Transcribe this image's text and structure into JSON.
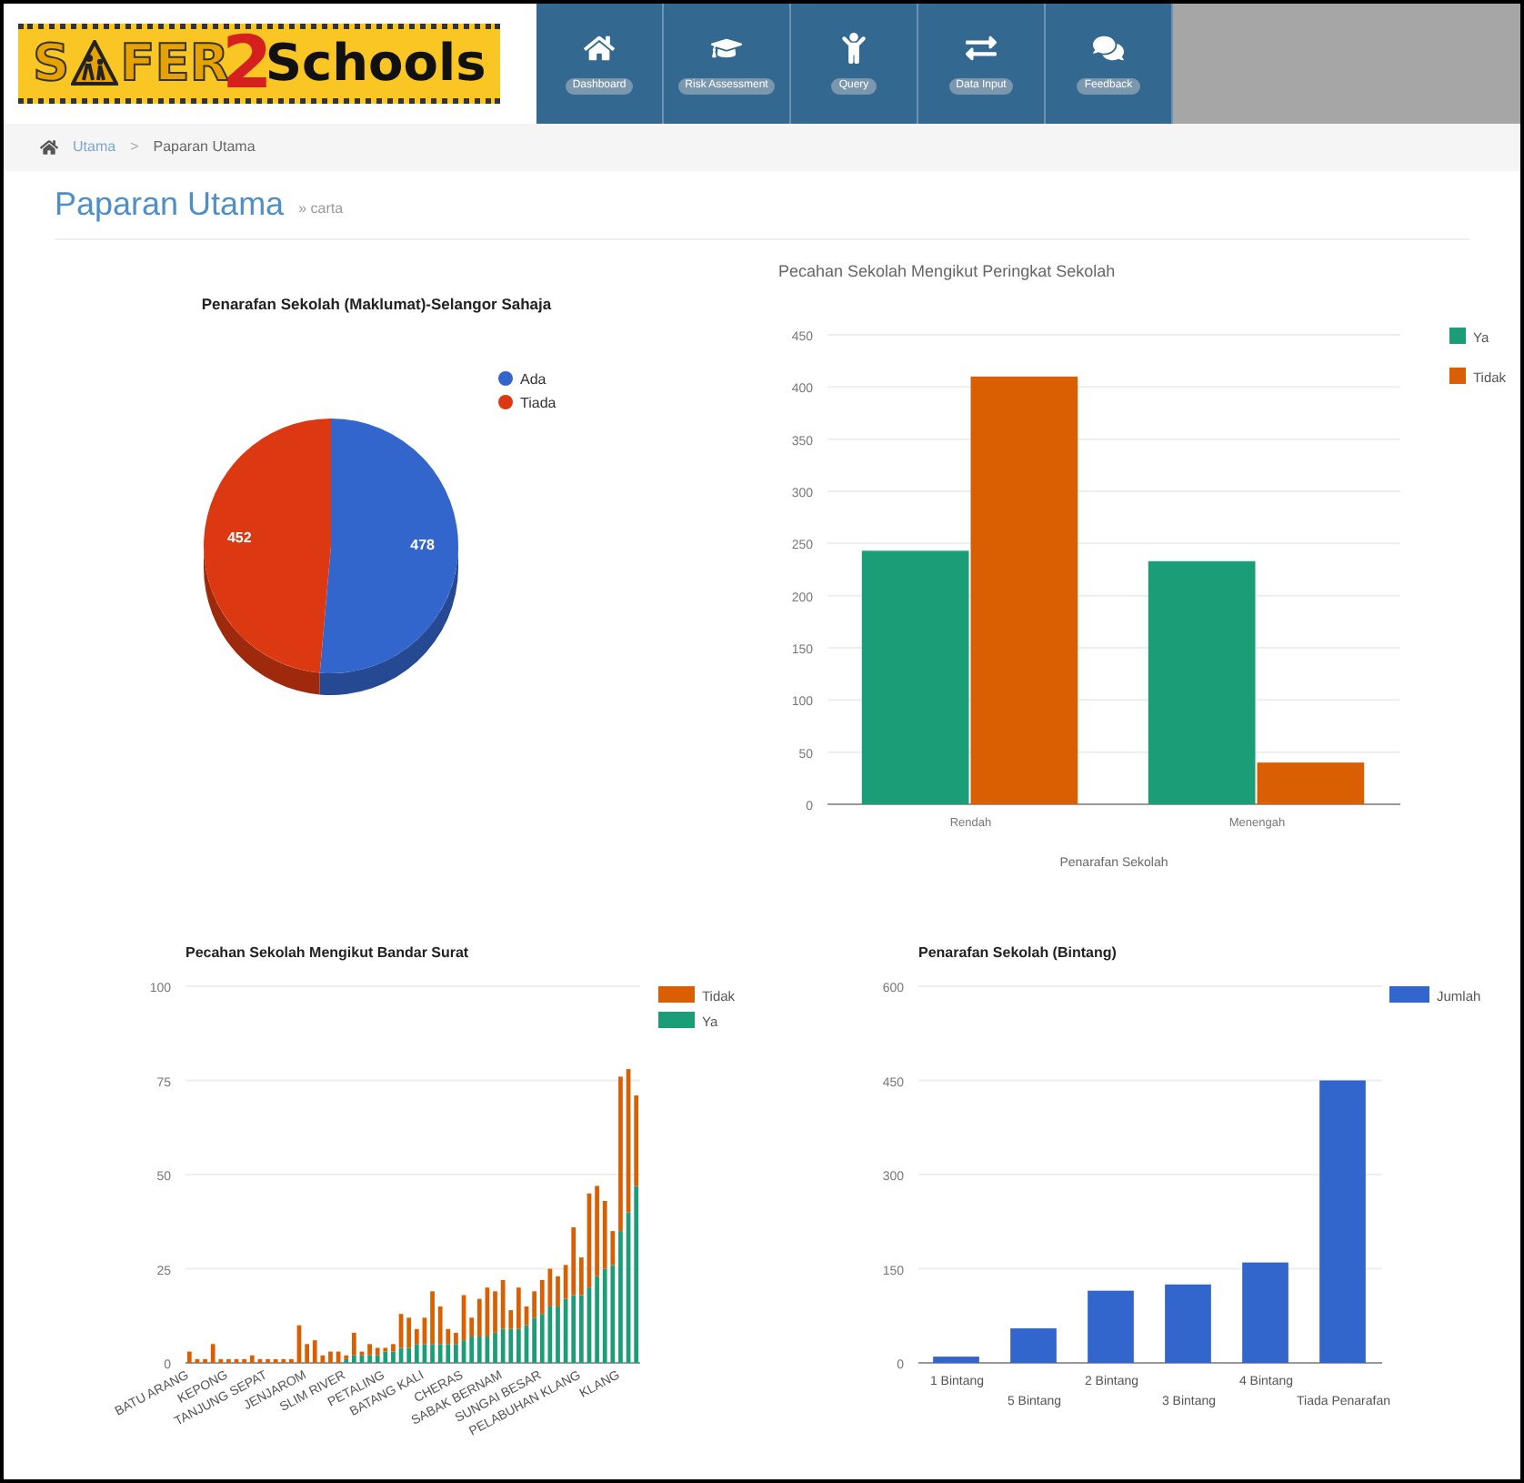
{
  "header": {
    "logo": {
      "left": "S",
      "middle": "FER",
      "numeral": "2",
      "right": "Schools"
    },
    "nav": [
      {
        "label": "Dashboard"
      },
      {
        "label": "Risk Assessment"
      },
      {
        "label": "Query"
      },
      {
        "label": "Data Input"
      },
      {
        "label": "Feedback"
      }
    ]
  },
  "breadcrumb": {
    "items": [
      "Utama",
      "Paparan Utama"
    ],
    "separator": ">"
  },
  "page": {
    "title": "Paparan Utama",
    "subtitle": "» carta"
  },
  "charts": [
    {
      "chart_data": {
        "type": "pie",
        "title": "Penarafan Sekolah (Maklumat)-Selangor Sahaja",
        "legend": "right",
        "categories": [
          "Ada",
          "Tiada"
        ],
        "data_labels": true,
        "values": [
          478,
          452
        ],
        "colors": [
          "#3366cc",
          "#dc3912"
        ]
      }
    },
    {
      "chart_data": {
        "type": "bar",
        "title": "Pecahan Sekolah Mengikut Peringkat Sekolah",
        "xlabel": "Penarafan Sekolah",
        "legend": "right",
        "grid": true,
        "categories": [
          "Rendah",
          "Menengah"
        ],
        "ylim": [
          0,
          450
        ],
        "yticks": [
          0,
          50,
          100,
          150,
          200,
          250,
          300,
          350,
          400,
          450
        ],
        "series": [
          {
            "name": "Ya",
            "color": "#1b9e77",
            "values": [
              243,
              233
            ]
          },
          {
            "name": "Tidak",
            "color": "#d95f02",
            "values": [
              410,
              40
            ]
          }
        ]
      }
    },
    {
      "chart_data": {
        "type": "bar",
        "title": "Pecahan Sekolah Mengikut Bandar Surat",
        "legend": "right",
        "grid": true,
        "stacked": true,
        "ylim": [
          0,
          100
        ],
        "yticks": [
          0,
          25,
          50,
          75,
          100
        ],
        "categories": [
          "BATU ARANG",
          null,
          null,
          null,
          null,
          "KEPONG",
          null,
          null,
          null,
          null,
          "TANJUNG SEPAT",
          null,
          null,
          null,
          null,
          "JENJAROM",
          null,
          null,
          null,
          null,
          "SLIM RIVER",
          null,
          null,
          null,
          null,
          "PETALING",
          null,
          null,
          null,
          null,
          "BATANG KALI",
          null,
          null,
          null,
          null,
          "CHERAS",
          null,
          null,
          null,
          null,
          "SABAK BERNAM",
          null,
          null,
          null,
          null,
          "SUNGAI BESAR",
          null,
          null,
          null,
          null,
          "PELABUHAN KLANG",
          null,
          null,
          null,
          null,
          "KLANG",
          null,
          null
        ],
        "series": [
          {
            "name": "Ya",
            "color": "#1b9e77",
            "values": [
              0,
              0,
              0,
              0,
              0,
              0,
              0,
              0,
              0,
              0,
              0,
              0,
              0,
              0,
              0,
              0,
              0,
              0,
              0,
              0,
              1,
              2,
              2,
              2,
              2,
              3,
              3,
              4,
              4,
              5,
              5,
              5,
              5,
              5,
              5,
              6,
              7,
              7,
              7,
              8,
              9,
              9,
              9,
              10,
              12,
              13,
              15,
              15,
              17,
              18,
              18,
              20,
              23,
              25,
              26,
              35,
              40,
              47
            ]
          },
          {
            "name": "Tidak",
            "color": "#d95f02",
            "values": [
              3,
              1,
              1,
              5,
              1,
              1,
              1,
              1,
              2,
              1,
              1,
              1,
              1,
              1,
              10,
              5,
              6,
              2,
              3,
              3,
              1,
              6,
              1,
              3,
              2,
              1,
              2,
              9,
              8,
              4,
              7,
              14,
              10,
              4,
              3,
              12,
              5,
              10,
              13,
              11,
              13,
              5,
              11,
              5,
              7,
              9,
              10,
              8,
              9,
              18,
              10,
              25,
              24,
              18,
              9,
              41,
              38,
              24
            ]
          }
        ]
      }
    },
    {
      "chart_data": {
        "type": "bar",
        "title": "Penarafan Sekolah (Bintang)",
        "legend": "right",
        "grid": true,
        "categories": [
          "1 Bintang",
          "5 Bintang",
          "2 Bintang",
          "3 Bintang",
          "4 Bintang",
          "Tiada Penarafan"
        ],
        "ylim": [
          0,
          600
        ],
        "yticks": [
          0,
          150,
          300,
          450,
          600
        ],
        "series": [
          {
            "name": "Jumlah",
            "color": "#3366cc",
            "values": [
              10,
              55,
              115,
              125,
              160,
              450
            ]
          }
        ]
      }
    }
  ]
}
